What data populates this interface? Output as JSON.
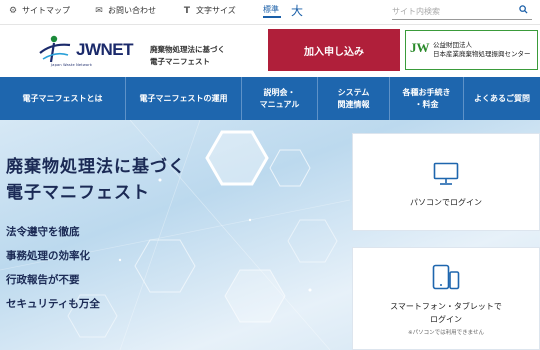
{
  "utility": {
    "sitemap": "サイトマップ",
    "contact": "お問い合わせ",
    "font_size_label": "文字サイズ",
    "size_standard": "標準",
    "size_large": "大",
    "search_placeholder": "サイト内検索"
  },
  "header": {
    "logo_text": "JWNET",
    "logo_sub": "Japan Waste Network",
    "tagline_line1": "廃棄物処理法に基づく",
    "tagline_line2": "電子マニフェスト",
    "join_button": "加入申し込み",
    "jw_line1": "公益財団法人",
    "jw_line2": "日本産業廃棄物処理振興センター",
    "jw_mark": "JW"
  },
  "nav": {
    "items": [
      {
        "label": "電子マニフェストとは"
      },
      {
        "label": "電子マニフェストの運用"
      },
      {
        "label": "説明会・",
        "label2": "マニュアル"
      },
      {
        "label": "システム",
        "label2": "関連情報"
      },
      {
        "label": "各種お手続き",
        "label2": "・料金"
      },
      {
        "label": "よくあるご質問"
      }
    ]
  },
  "hero": {
    "title_line1": "廃棄物処理法に基づく",
    "title_line2": "電子マニフェスト",
    "points": [
      "法令遵守を徹底",
      "事務処理の効率化",
      "行政報告が不要",
      "セキュリティも万全"
    ]
  },
  "login": {
    "pc_label": "パソコンでログイン",
    "sp_label_line1": "スマートフォン・タブレットで",
    "sp_label_line2": "ログイン",
    "sp_note": "※パソコンでは利用できません"
  },
  "colors": {
    "nav_bg": "#1e66ae",
    "join_bg": "#b01f3a",
    "jw_green": "#3a9b3a",
    "text_dark": "#1b2a55"
  }
}
